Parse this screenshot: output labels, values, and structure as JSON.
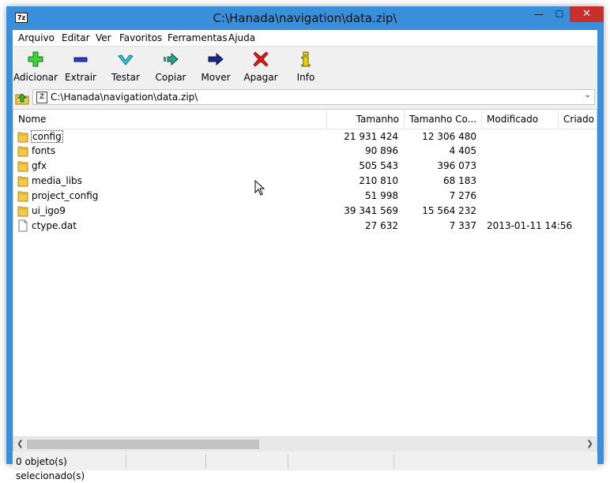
{
  "window": {
    "title": "C:\\Hanada\\navigation\\data.zip\\",
    "app_icon_text": "7z"
  },
  "menu": [
    {
      "label": "Arquivo"
    },
    {
      "label": "Editar"
    },
    {
      "label": "Ver"
    },
    {
      "label": "Favoritos"
    },
    {
      "label": "Ferramentas"
    },
    {
      "label": "Ajuda"
    }
  ],
  "toolbar": [
    {
      "label": "Adicionar",
      "icon": "plus-icon",
      "color": "#2fc12f"
    },
    {
      "label": "Extrair",
      "icon": "minus-icon",
      "color": "#1f2fb0"
    },
    {
      "label": "Testar",
      "icon": "check-icon",
      "color": "#27b6c9"
    },
    {
      "label": "Copiar",
      "icon": "copy-arrow-icon",
      "color": "#2f8f8f"
    },
    {
      "label": "Mover",
      "icon": "move-arrow-icon",
      "color": "#1a2a8a"
    },
    {
      "label": "Apagar",
      "icon": "delete-x-icon",
      "color": "#d01818"
    },
    {
      "label": "Info",
      "icon": "info-icon",
      "color": "#e0c000"
    }
  ],
  "address": {
    "path": "C:\\Hanada\\navigation\\data.zip\\"
  },
  "columns": {
    "name": "Nome",
    "size": "Tamanho",
    "packed": "Tamanho Co...",
    "modified": "Modificado",
    "created": "Criado"
  },
  "files": [
    {
      "name": "config",
      "type": "folder",
      "size": "21 931 424",
      "packed": "12 306 480",
      "modified": ""
    },
    {
      "name": "fonts",
      "type": "folder",
      "size": "90 896",
      "packed": "4 405",
      "modified": ""
    },
    {
      "name": "gfx",
      "type": "folder",
      "size": "505 543",
      "packed": "396 073",
      "modified": ""
    },
    {
      "name": "media_libs",
      "type": "folder",
      "size": "210 810",
      "packed": "68 183",
      "modified": ""
    },
    {
      "name": "project_config",
      "type": "folder",
      "size": "51 998",
      "packed": "7 276",
      "modified": ""
    },
    {
      "name": "ui_igo9",
      "type": "folder",
      "size": "39 341 569",
      "packed": "15 564 232",
      "modified": ""
    },
    {
      "name": "ctype.dat",
      "type": "file",
      "size": "27 632",
      "packed": "7 337",
      "modified": "2013-01-11 14:56"
    }
  ],
  "status": {
    "selection": "0 objeto(s) selecionado(s)"
  }
}
